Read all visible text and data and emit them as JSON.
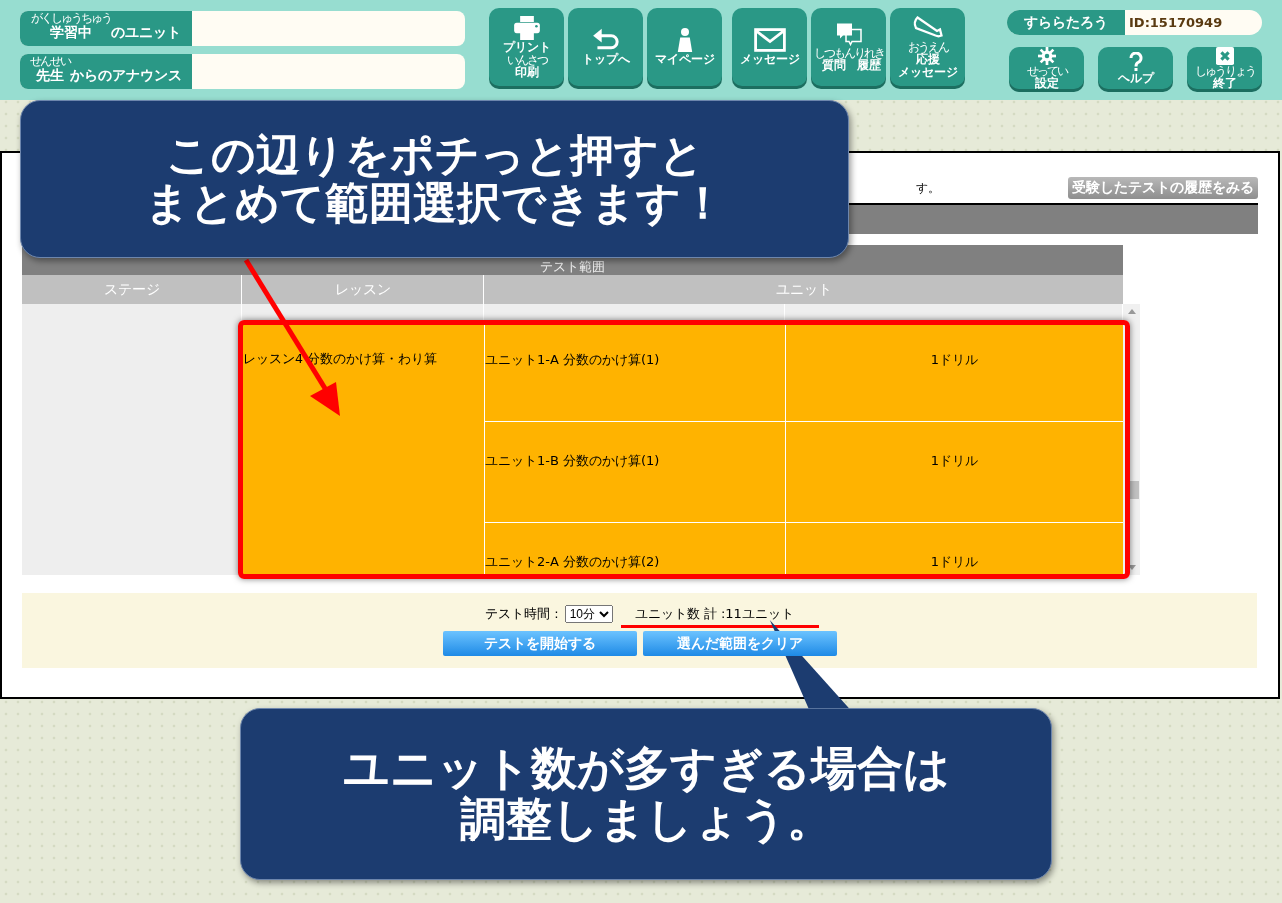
{
  "header": {
    "info_fields": [
      {
        "label": [
          {
            "text": "学習中",
            "ruby": "がくしゅうちゅう"
          },
          {
            "text": "のユニット"
          }
        ]
      },
      {
        "label": [
          {
            "text": "先生",
            "ruby": "せんせい"
          },
          {
            "text": "からのアナウンス"
          }
        ]
      }
    ],
    "nav_buttons": [
      {
        "kind": "printer",
        "lines": [
          [
            {
              "text": "プリント"
            }
          ],
          [
            {
              "text": "印刷",
              "ruby": "いんさつ"
            }
          ]
        ]
      },
      {
        "kind": "return",
        "lines": [
          [
            {
              "text": "トップへ"
            }
          ]
        ]
      },
      {
        "kind": "person",
        "lines": [
          [
            {
              "text": "マイページ"
            }
          ]
        ]
      },
      {
        "kind": "envelope",
        "lines": [
          [
            {
              "text": "メッセージ"
            }
          ]
        ]
      },
      {
        "kind": "speech",
        "lines": [
          [
            {
              "text": "質問",
              "ruby": "しつもん"
            },
            {
              "text": "履歴",
              "ruby": "りれき"
            }
          ]
        ]
      },
      {
        "kind": "megaphone",
        "lines": [
          [
            {
              "text": "応援",
              "ruby": "おうえん"
            }
          ],
          [
            {
              "text": "メッセージ"
            }
          ]
        ]
      }
    ],
    "user": {
      "name": "すららたろう",
      "id": "ID:15170949"
    },
    "util_buttons": [
      {
        "kind": "gear",
        "lines": [
          [
            {
              "text": "設定",
              "ruby": "せってい"
            }
          ]
        ]
      },
      {
        "kind": "question",
        "lines": [
          [
            {
              "text": "ヘルプ"
            }
          ]
        ]
      },
      {
        "kind": "close",
        "lines": [
          [
            {
              "text": "終了",
              "ruby": "しゅうりょう"
            }
          ]
        ]
      }
    ]
  },
  "main": {
    "notice": "す。",
    "history_button": "受験したテストの履歴をみる",
    "table": {
      "title": "テスト範囲",
      "columns": [
        "ステージ",
        "レッスン",
        "ユニット"
      ],
      "lesson": {
        "text": "レッスン4 分数のかけ算・わり算",
        "selected": true
      },
      "units": [
        {
          "name": "ユニット1-A 分数のかけ算(1)",
          "drill": "1ドリル",
          "selected": true
        },
        {
          "name": "ユニット1-B 分数のかけ算(1)",
          "drill": "1ドリル",
          "selected": true
        },
        {
          "name": "ユニット2-A 分数のかけ算(2)",
          "drill": "1ドリル",
          "selected": true
        }
      ]
    },
    "footer": {
      "time_label": "テスト時間 :",
      "time_value": "10分",
      "unit_total": "ユニット数 計 :11ユニット",
      "buttons": [
        "テストを開始する",
        "選んだ範囲をクリア"
      ]
    }
  },
  "annotations": [
    {
      "lines": [
        "この辺りをポチっと押すと",
        "まとめて範囲選択できます！"
      ]
    },
    {
      "lines": [
        "ユニット数が多すぎる場合は",
        "調整しましょう。"
      ]
    }
  ]
}
